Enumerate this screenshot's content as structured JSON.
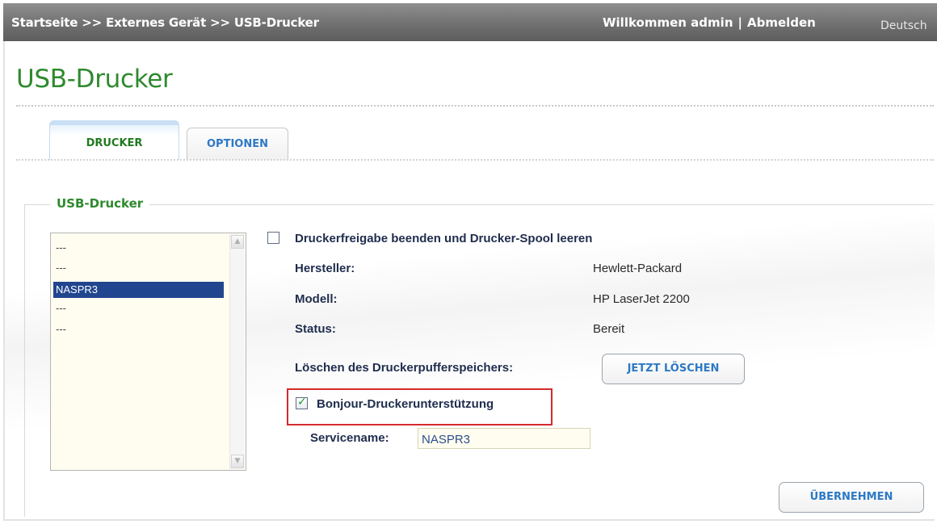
{
  "header": {
    "breadcrumb": "Startseite >> Externes Gerät >> USB-Drucker",
    "welcome": "Willkommen admin",
    "separator": "|",
    "logout": "Abmelden",
    "language": "Deutsch"
  },
  "page": {
    "title": "USB-Drucker"
  },
  "tabs": [
    {
      "label": "DRUCKER",
      "active": true
    },
    {
      "label": "OPTIONEN",
      "active": false
    }
  ],
  "group": {
    "legend": "USB-Drucker"
  },
  "printer_list": {
    "items": [
      "---",
      "---",
      "NASPR3",
      "---",
      "---"
    ],
    "selected_index": 2
  },
  "details": {
    "stop_sharing_label": "Druckerfreigabe beenden und Drucker-Spool leeren",
    "stop_sharing_checked": false,
    "manufacturer_label": "Hersteller:",
    "manufacturer_value": "Hewlett-Packard",
    "model_label": "Modell:",
    "model_value": "HP LaserJet 2200",
    "status_label": "Status:",
    "status_value": "Bereit",
    "clear_spool_label": "Löschen des Druckerpufferspeichers:",
    "clear_now_button": "JETZT LÖSCHEN",
    "bonjour_label": "Bonjour-Druckerunterstützung",
    "bonjour_checked": true,
    "service_name_label": "Servicename:",
    "service_name_value": "NASPR3"
  },
  "actions": {
    "apply_button": "ÜBERNEHMEN"
  },
  "colors": {
    "accent_green": "#2e8a2e",
    "link_blue": "#2d79c5",
    "selection_blue": "#21458f",
    "highlight_red": "#d22b2b"
  }
}
